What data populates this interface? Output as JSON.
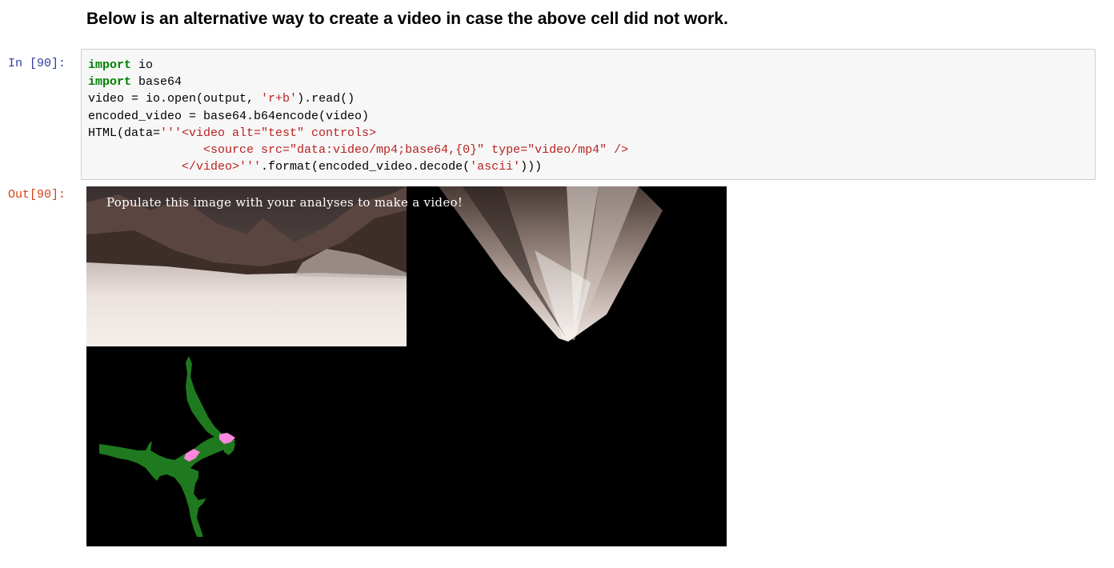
{
  "markdown": {
    "heading": "Below is an alternative way to create a video in case the above cell did not work."
  },
  "cell": {
    "in_prompt": "In [90]:",
    "out_prompt": "Out[90]:",
    "code": {
      "line1_kw": "import",
      "line1_rest": " io",
      "line2_kw": "import",
      "line2_rest": " base64",
      "line3_a": "video = io.open(output, ",
      "line3_str": "'r+b'",
      "line3_b": ").read()",
      "line4": "encoded_video = base64.b64encode(video)",
      "line5_a": "HTML(data=",
      "line5_str": "'''<video alt=\"test\" controls>",
      "line6_str": "                <source src=\"data:video/mp4;base64,{0}\" type=\"video/mp4\" />",
      "line7_str": "             </video>'''",
      "line7_a": ".format(encoded_video.decode(",
      "line7_str2": "'ascii'",
      "line7_b": ")))"
    }
  },
  "output": {
    "overlay_text": "Populate this image with your analyses to make a video!",
    "colors": {
      "background": "#000000",
      "map_navigable": "#1f7a1f",
      "rover_marker": "#ff88dd",
      "terrain_sand": "#e8ddd8",
      "terrain_rock": "#5a4540"
    }
  }
}
